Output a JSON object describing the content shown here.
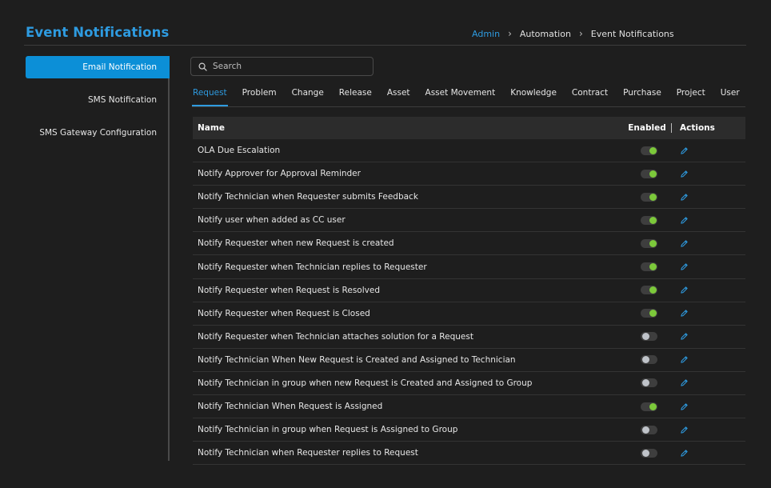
{
  "header": {
    "title": "Event Notifications",
    "breadcrumb": [
      "Admin",
      "Automation",
      "Event Notifications"
    ]
  },
  "sidebar": {
    "items": [
      {
        "label": "Email Notification",
        "active": true
      },
      {
        "label": "SMS Notification",
        "active": false
      },
      {
        "label": "SMS Gateway Configuration",
        "active": false
      }
    ]
  },
  "search": {
    "placeholder": "Search",
    "value": ""
  },
  "tabs": [
    {
      "label": "Request",
      "active": true
    },
    {
      "label": "Problem",
      "active": false
    },
    {
      "label": "Change",
      "active": false
    },
    {
      "label": "Release",
      "active": false
    },
    {
      "label": "Asset",
      "active": false
    },
    {
      "label": "Asset Movement",
      "active": false
    },
    {
      "label": "Knowledge",
      "active": false
    },
    {
      "label": "Contract",
      "active": false
    },
    {
      "label": "Purchase",
      "active": false
    },
    {
      "label": "Project",
      "active": false
    },
    {
      "label": "User",
      "active": false
    }
  ],
  "table": {
    "columns": {
      "name": "Name",
      "enabled": "Enabled",
      "actions": "Actions"
    },
    "rows": [
      {
        "name": "OLA Due Escalation",
        "enabled": true
      },
      {
        "name": "Notify Approver for Approval Reminder",
        "enabled": true
      },
      {
        "name": "Notify Technician when Requester submits Feedback",
        "enabled": true
      },
      {
        "name": "Notify user when added as CC user",
        "enabled": true
      },
      {
        "name": "Notify Requester when new Request is created",
        "enabled": true
      },
      {
        "name": "Notify Requester when Technician replies to Requester",
        "enabled": true
      },
      {
        "name": "Notify Requester when Request is Resolved",
        "enabled": true
      },
      {
        "name": "Notify Requester when Request is Closed",
        "enabled": true
      },
      {
        "name": "Notify Requester when Technician attaches solution for a Request",
        "enabled": false
      },
      {
        "name": "Notify Technician When New Request is Created and Assigned to Technician",
        "enabled": false
      },
      {
        "name": "Notify Technician in group when new Request is Created and Assigned to Group",
        "enabled": false
      },
      {
        "name": "Notify Technician When Request is Assigned",
        "enabled": true
      },
      {
        "name": "Notify Technician in group when Request is Assigned to Group",
        "enabled": false
      },
      {
        "name": "Notify Technician when Requester replies to Request",
        "enabled": false
      }
    ]
  },
  "colors": {
    "accent": "#2e9be0",
    "active_nav": "#0c8fd7",
    "toggle_on": "#7cc93a",
    "toggle_off": "#bfc3c9",
    "background": "#1e1e1e"
  },
  "icons": {
    "search": "search-icon",
    "edit": "pencil-icon",
    "breadcrumb_separator": "chevron-right-icon"
  }
}
